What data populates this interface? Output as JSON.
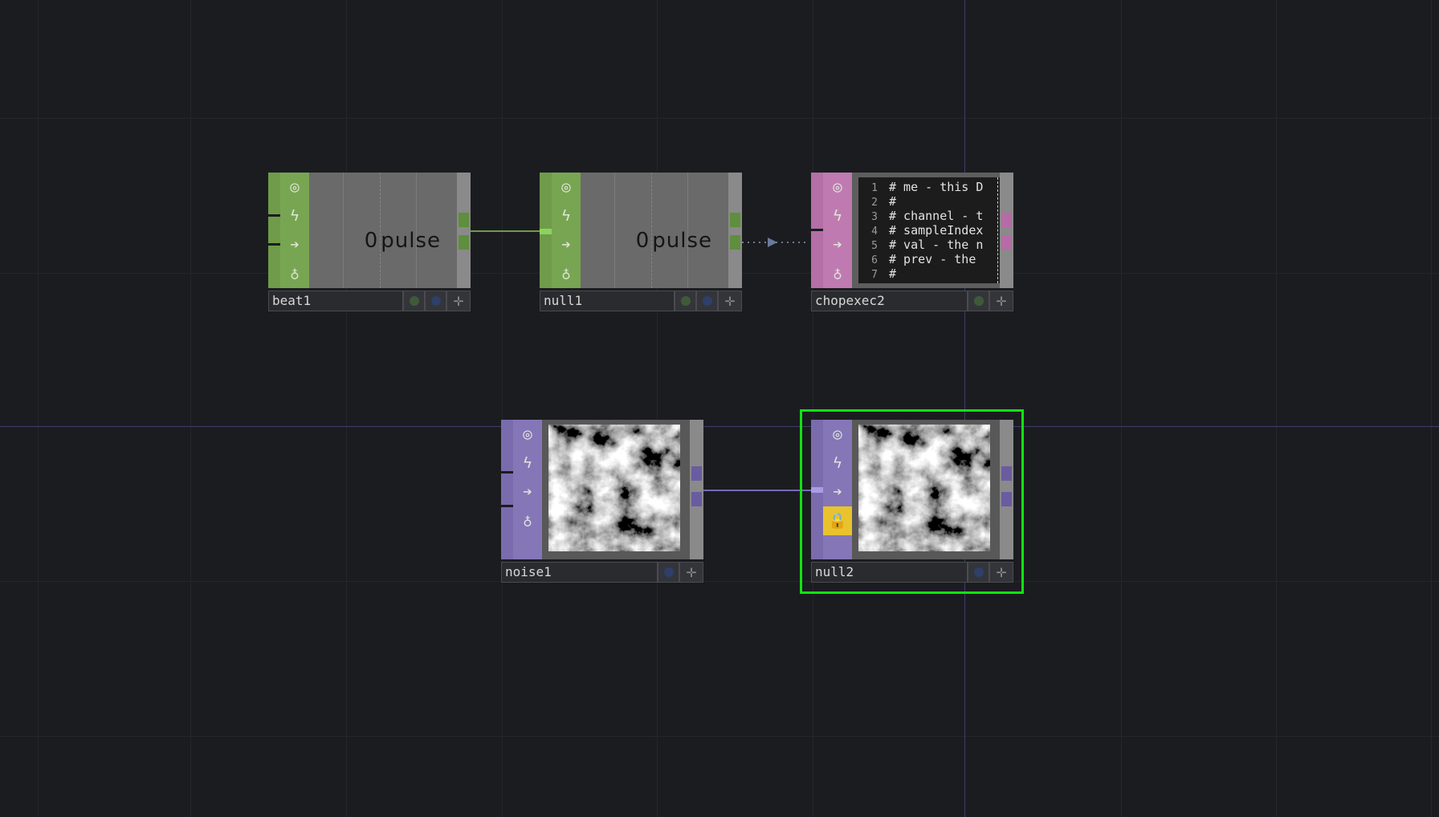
{
  "nodes": [
    {
      "id": "beat1",
      "name": "beat1",
      "family": "CHOP",
      "display": {
        "value": "0",
        "channel": "pulse"
      }
    },
    {
      "id": "null1",
      "name": "null1",
      "family": "CHOP",
      "display": {
        "value": "0",
        "channel": "pulse"
      }
    },
    {
      "id": "chopexec2",
      "name": "chopexec2",
      "family": "DAT",
      "code_lines": [
        {
          "n": "1",
          "text": "# me - this D"
        },
        {
          "n": "2",
          "text": "#"
        },
        {
          "n": "3",
          "text": "# channel - t"
        },
        {
          "n": "4",
          "text": "# sampleIndex"
        },
        {
          "n": "5",
          "text": "# val - the n"
        },
        {
          "n": "6",
          "text": "# prev - the"
        },
        {
          "n": "7",
          "text": "#"
        }
      ]
    },
    {
      "id": "noise1",
      "name": "noise1",
      "family": "TOP"
    },
    {
      "id": "null2",
      "name": "null2",
      "family": "TOP",
      "selected": true,
      "locked": true
    }
  ],
  "flag_icons": [
    "viewer-active-icon",
    "cook-bypass-icon",
    "display-flag-icon",
    "lock-icon"
  ],
  "connections": [
    {
      "from": "beat1",
      "to": "null1",
      "type": "wire"
    },
    {
      "from": "null1",
      "to": "chopexec2",
      "type": "reference"
    },
    {
      "from": "noise1",
      "to": "null2",
      "type": "wire"
    }
  ],
  "colors": {
    "background": "#1b1c20",
    "chop": "#78a552",
    "dat": "#bf7bb1",
    "top": "#8576b8",
    "selection": "#12e212",
    "lock_active": "#e8c32e"
  }
}
